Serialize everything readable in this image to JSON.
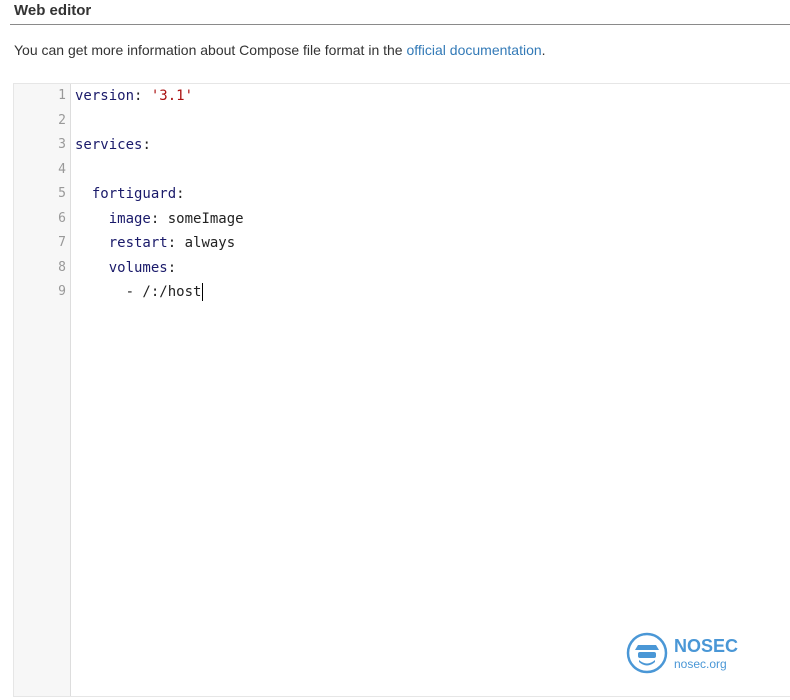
{
  "section": {
    "title": "Web editor"
  },
  "help": {
    "text": "You can get more information about Compose file format in the ",
    "link": "official documentation",
    "suffix": "."
  },
  "editor": {
    "line_numbers": [
      "1",
      "2",
      "3",
      "4",
      "5",
      "6",
      "7",
      "8",
      "9"
    ],
    "lines": [
      {
        "indent": "",
        "key": "version",
        "sep": ": ",
        "str": "'3.1'",
        "plain": ""
      },
      {
        "indent": "",
        "key": "",
        "sep": "",
        "str": "",
        "plain": ""
      },
      {
        "indent": "",
        "key": "services",
        "sep": ":",
        "str": "",
        "plain": ""
      },
      {
        "indent": "",
        "key": "",
        "sep": "",
        "str": "",
        "plain": ""
      },
      {
        "indent": "  ",
        "key": "fortiguard",
        "sep": ":",
        "str": "",
        "plain": ""
      },
      {
        "indent": "    ",
        "key": "image",
        "sep": ": ",
        "str": "",
        "plain": "someImage"
      },
      {
        "indent": "    ",
        "key": "restart",
        "sep": ": ",
        "str": "",
        "plain": "always"
      },
      {
        "indent": "    ",
        "key": "volumes",
        "sep": ":",
        "str": "",
        "plain": ""
      },
      {
        "indent": "      ",
        "key": "",
        "sep": "",
        "str": "",
        "plain": "- /:/host"
      }
    ],
    "cursor_line": 9
  },
  "watermark": {
    "title": "NOSEC",
    "subtitle": "nosec.org"
  },
  "colors": {
    "link": "#337ab7",
    "key": "#1a1a6a",
    "string": "#aa1111",
    "watermark": "#4a97d6"
  }
}
